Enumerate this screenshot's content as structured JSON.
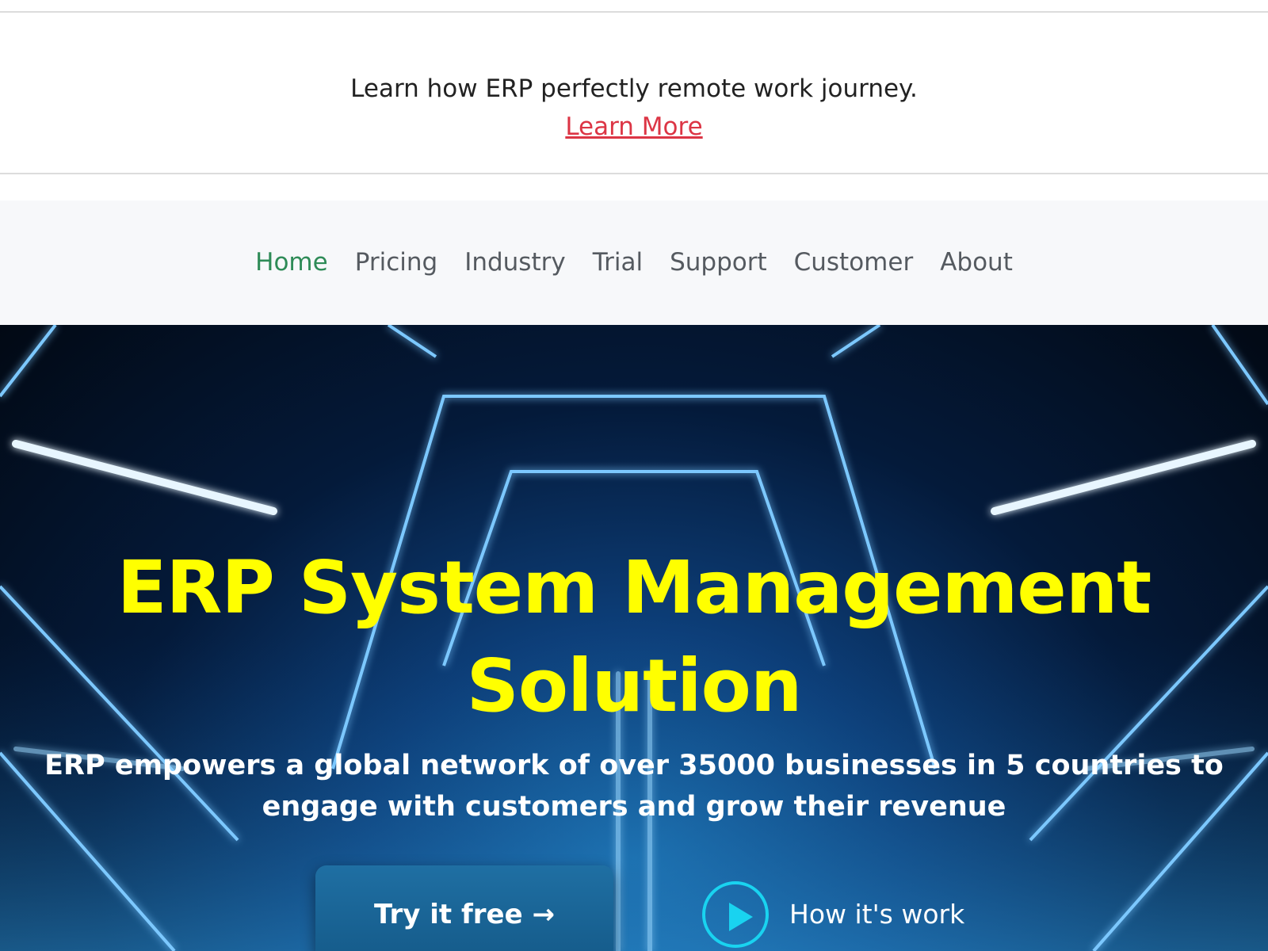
{
  "announcement": {
    "text": "Learn how ERP perfectly remote work journey.",
    "link_label": "Learn More"
  },
  "nav": {
    "items": [
      {
        "label": "Home",
        "active": true
      },
      {
        "label": "Pricing"
      },
      {
        "label": "Industry"
      },
      {
        "label": "Trial"
      },
      {
        "label": "Support"
      },
      {
        "label": "Customer"
      },
      {
        "label": "About"
      }
    ]
  },
  "hero": {
    "title_line1": "ERP System Management",
    "title_line2": "Solution",
    "subtitle": "ERP empowers a global network of over 35000 businesses in 5 countries to engage with customers and grow their revenue",
    "primary_button": "Try it free →",
    "video_label": "How it's work"
  },
  "colors": {
    "title": "#ffff00",
    "nav_active": "#2e8b57",
    "link": "#dc3545",
    "play_accent": "#19d3f0"
  }
}
